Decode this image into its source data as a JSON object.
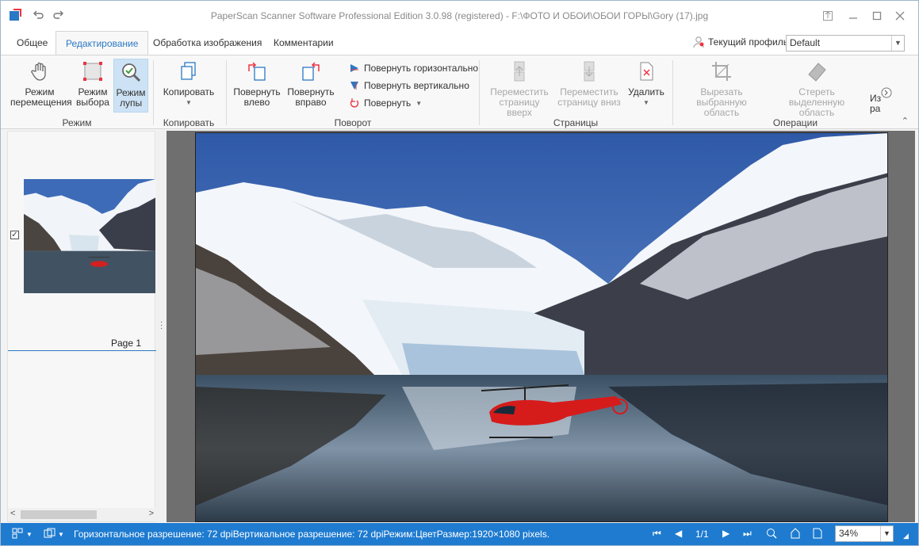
{
  "window": {
    "title": "PaperScan Scanner Software Professional Edition 3.0.98 (registered) - F:\\ФОТО И ОБОИ\\ОБОИ ГОРЫ\\Gory (17).jpg"
  },
  "tabs": [
    {
      "label": "Общее",
      "active": false
    },
    {
      "label": "Редактирование",
      "active": true
    },
    {
      "label": "Обработка изображения",
      "active": false
    },
    {
      "label": "Комментарии",
      "active": false
    }
  ],
  "profile": {
    "label": "Текущий профиль:",
    "value": "Default"
  },
  "ribbon": {
    "mode": {
      "pan_line1": "Режим",
      "pan_line2": "перемещения",
      "select_line1": "Режим",
      "select_line2": "выбора",
      "zoom_line1": "Режим",
      "zoom_line2": "лупы",
      "group": "Режим"
    },
    "copy": {
      "label": "Копировать",
      "group": "Копировать"
    },
    "rotate": {
      "left_line1": "Повернуть",
      "left_line2": "влево",
      "right_line1": "Повернуть",
      "right_line2": "вправо",
      "flip_h": "Повернуть горизонтально",
      "flip_v": "Повернуть вертикально",
      "rotate": "Повернуть",
      "group": "Поворот"
    },
    "pages": {
      "up_line1": "Переместить",
      "up_line2": "страницу вверх",
      "down_line1": "Переместить",
      "down_line2": "страницу вниз",
      "delete": "Удалить",
      "group": "Страницы"
    },
    "operations": {
      "crop_line1": "Вырезать",
      "crop_line2": "выбранную область",
      "erase_line1": "Стереть выделенную",
      "erase_line2": "область",
      "more_line1": "Из",
      "more_line2": "ра",
      "group": "Операции"
    }
  },
  "thumbnails": [
    {
      "label": "Page 1",
      "checked": true
    }
  ],
  "status": {
    "text": "Горизонтальное разрешение: 72 dpiВертикальное разрешение: 72 dpiРежим:ЦветРазмер:1920×1080 pixels.",
    "page": "1/1",
    "zoom": "34%"
  },
  "colors": {
    "accent": "#2b78c4",
    "statusbar": "#1e7bd0"
  }
}
